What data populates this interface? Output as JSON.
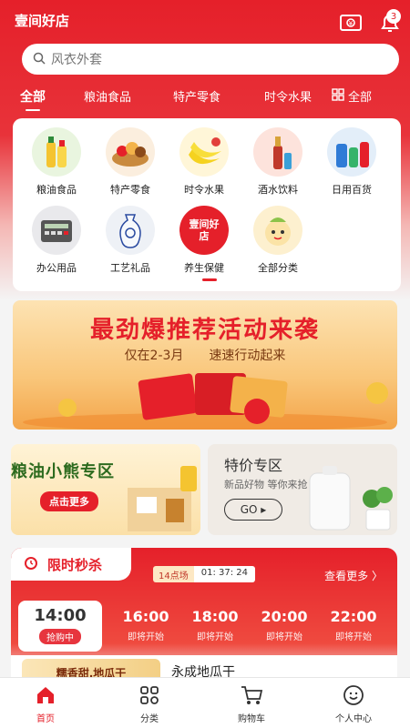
{
  "app": {
    "title": "壹间好店",
    "notification_count": "3"
  },
  "search": {
    "placeholder": "风衣外套"
  },
  "category_tabs": [
    "全部",
    "粮油食品",
    "特产零食",
    "时令水果",
    "全部"
  ],
  "categories": [
    {
      "label": "粮油食品",
      "icon": "cooking-oil-icon"
    },
    {
      "label": "特产零食",
      "icon": "snack-basket-icon"
    },
    {
      "label": "时令水果",
      "icon": "banana-icon"
    },
    {
      "label": "酒水饮料",
      "icon": "bottle-icon"
    },
    {
      "label": "日用百货",
      "icon": "daily-goods-icon"
    },
    {
      "label": "办公用品",
      "icon": "calculator-icon"
    },
    {
      "label": "工艺礼品",
      "icon": "porcelain-vase-icon"
    },
    {
      "label": "养生保健",
      "icon": "brand-logo-icon"
    },
    {
      "label": "全部分类",
      "icon": "mascot-icon"
    }
  ],
  "category_logo_text": "壹间好店",
  "banners": {
    "promo": {
      "title": "最劲爆推荐活动来袭",
      "subtitle_left": "仅在2-3月",
      "subtitle_right": "速速行动起来"
    },
    "bear_zone": {
      "title": "粮油小熊专区",
      "button": "点击更多"
    },
    "special": {
      "title": "特价专区",
      "subtitle": "新品好物 等你来抢",
      "button": "GO ▸"
    }
  },
  "flash_sale": {
    "title": "限时秒杀",
    "session_label": "14点场",
    "countdown": "01: 37: 24",
    "more": "查看更多 〉",
    "slots": [
      {
        "time": "14:00",
        "status": "抢购中"
      },
      {
        "time": "16:00",
        "status": "即将开始"
      },
      {
        "time": "18:00",
        "status": "即将开始"
      },
      {
        "time": "20:00",
        "status": "即将开始"
      },
      {
        "time": "22:00",
        "status": "即将开始"
      }
    ],
    "product": {
      "tag": "糯香甜,地瓜干",
      "name": "永成地瓜干"
    }
  },
  "bottom_nav": [
    {
      "label": "首页",
      "icon": "home-icon"
    },
    {
      "label": "分类",
      "icon": "category-grid-icon"
    },
    {
      "label": "购物车",
      "icon": "cart-icon"
    },
    {
      "label": "个人中心",
      "icon": "user-icon"
    }
  ],
  "colors": {
    "primary": "#e5202a",
    "accent": "#f4a54a"
  }
}
